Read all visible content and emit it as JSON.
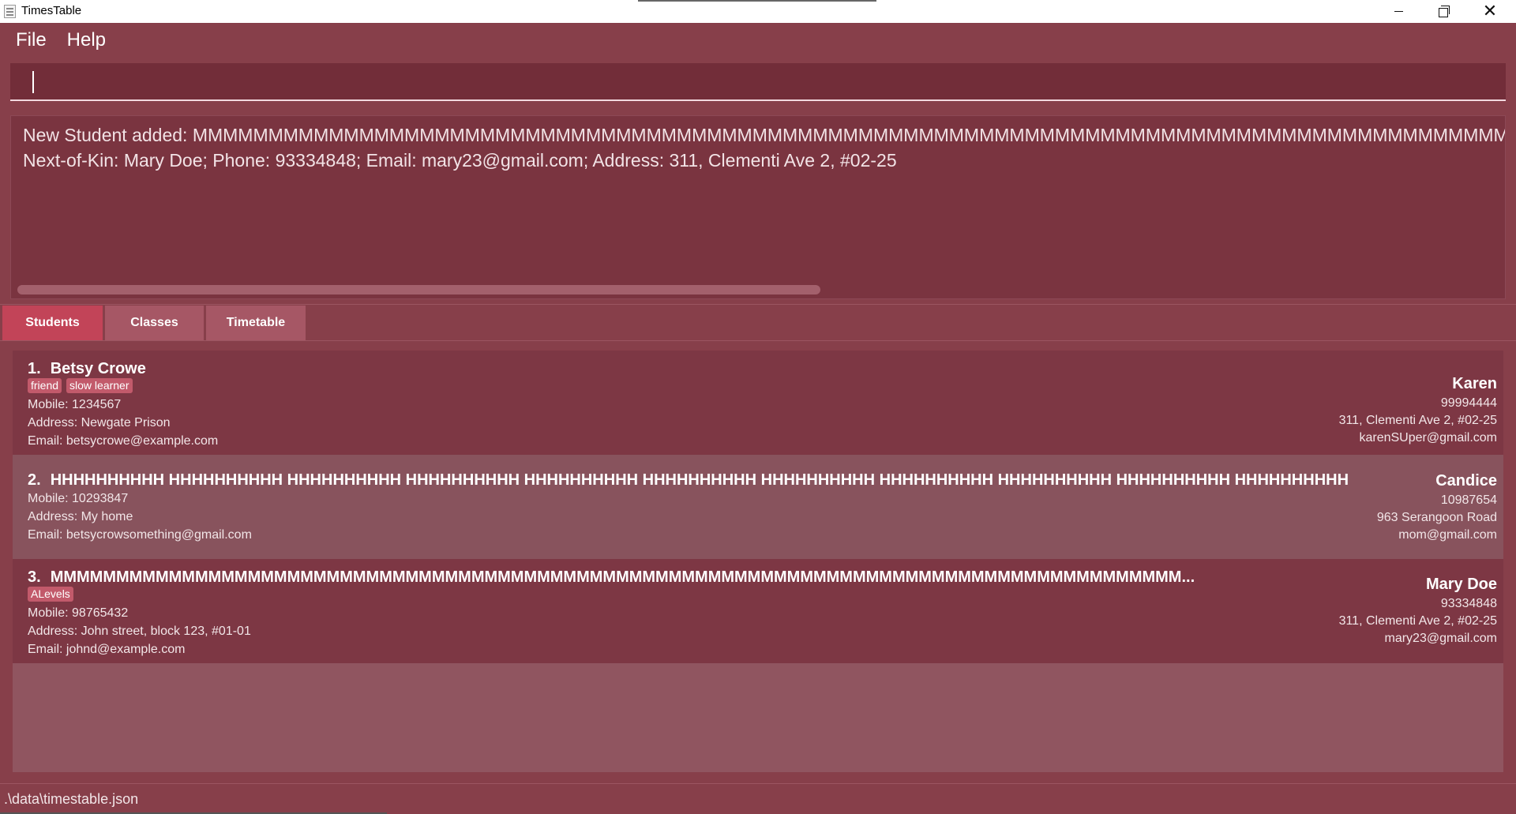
{
  "window": {
    "title": "TimesTable",
    "app_icon": "document-icon",
    "controls": {
      "minimize": "minimize-icon",
      "maximize": "restore-icon",
      "close": "close-icon"
    }
  },
  "menu": {
    "items": [
      {
        "label": "File"
      },
      {
        "label": "Help"
      }
    ]
  },
  "command_box": {
    "value": "",
    "placeholder": ""
  },
  "result_display": {
    "line1": "New Student added: MMMMMMMMMMMMMMMMMMMMMMMMMMMMMMMMMMMMMMMMMMMMMMMMMMMMMMMMMMMMMMMMMMMMMMMMMMMMMMMMMMMMMMMMMMMMMMMMMMMMMMMMMMMMMMMMMMM",
    "line2": "Next-of-Kin: Mary Doe; Phone: 93334848; Email: mary23@gmail.com; Address: 311, Clementi Ave 2, #02-25"
  },
  "tabs": [
    {
      "label": "Students",
      "active": true
    },
    {
      "label": "Classes",
      "active": false
    },
    {
      "label": "Timetable",
      "active": false
    }
  ],
  "students": [
    {
      "index": "1.",
      "name": "Betsy Crowe",
      "tags": [
        "friend",
        "slow learner"
      ],
      "mobile": "Mobile: 1234567",
      "address": "Address: Newgate Prison",
      "email": "Email: betsycrowe@example.com",
      "kin": {
        "name": "Karen",
        "phone": "99994444",
        "address": "311, Clementi Ave 2, #02-25",
        "email": "karenSUper@gmail.com"
      }
    },
    {
      "index": "2.",
      "name": "HHHHHHHHHH HHHHHHHHHH HHHHHHHHHH HHHHHHHHHH HHHHHHHHHH HHHHHHHHHH HHHHHHHHHH HHHHHHHHHH HHHHHHHHHH HHHHHHHHHH HHHHHHHHHH",
      "tags": [],
      "mobile": "Mobile: 10293847",
      "address": "Address: My home",
      "email": "Email: betsycrowsomething@gmail.com",
      "kin": {
        "name": "Candice",
        "phone": "10987654",
        "address": "963 Serangoon Road",
        "email": "mom@gmail.com"
      }
    },
    {
      "index": "3.",
      "name": "MMMMMMMMMMMMMMMMMMMMMMMMMMMMMMMMMMMMMMMMMMMMMMMMMMMMMMMMMMMMMMMMMMMMMMMMMMMMMMMMMMMMMM...",
      "tags": [
        "ALevels"
      ],
      "mobile": "Mobile: 98765432",
      "address": "Address: John street, block 123, #01-01",
      "email": "Email: johnd@example.com",
      "kin": {
        "name": "Mary Doe",
        "phone": "93334848",
        "address": "311, Clementi Ave 2, #02-25",
        "email": "mary23@gmail.com"
      }
    }
  ],
  "status_bar": {
    "path": ".\\data\\timestable.json"
  },
  "colors": {
    "background": "#873f4a",
    "command_bg": "#722d39",
    "active_tab": "#c24458",
    "inactive_tab": "#a65765",
    "tag_bg": "#c25a6b",
    "card_odd": "#7d3744",
    "card_even": "#88535d"
  }
}
